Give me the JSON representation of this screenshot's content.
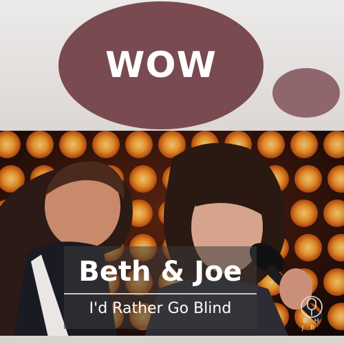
{
  "bubble": {
    "text": "WOW"
  },
  "caption": {
    "title": "Beth & Joe",
    "subtitle": "I'd Rather Go Blind"
  },
  "logo": {
    "text": "BH JB",
    "icon": "microphone-icon"
  },
  "colors": {
    "bubble_large": "#7a4a51",
    "bubble_small": "#8e666b",
    "background": "#e4e1df",
    "stage_lights": "#f39a2c"
  }
}
